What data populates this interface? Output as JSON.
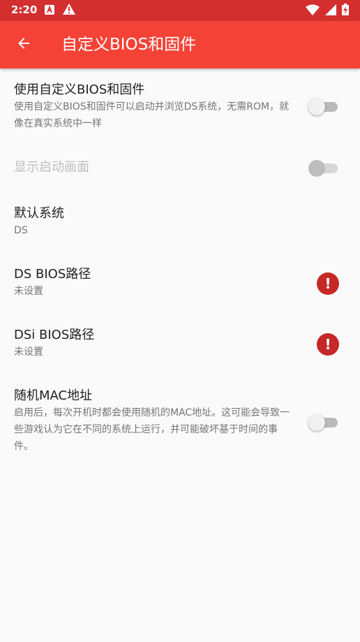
{
  "status_bar": {
    "time": "2:20",
    "left_icons": [
      "a-notification-icon",
      "warning-icon"
    ],
    "right_icons": [
      "wifi-icon",
      "signal-icon",
      "battery-charging-icon"
    ]
  },
  "app_bar": {
    "title": "自定义BIOS和固件",
    "back_icon": "arrow-back-icon"
  },
  "colors": {
    "status_bar": "#d32f2f",
    "app_bar": "#f44336",
    "alert": "#c62828"
  },
  "preferences": [
    {
      "title": "使用自定义BIOS和固件",
      "summary": "使用自定义BIOS和固件可以启动并浏览DS系统，无需ROM，就像在真实系统中一样",
      "widget": "switch",
      "checked": false,
      "enabled": true
    },
    {
      "title": "显示启动画面",
      "summary": "",
      "widget": "switch",
      "checked": false,
      "enabled": false
    },
    {
      "title": "默认系统",
      "summary": "DS",
      "widget": "none",
      "enabled": true
    },
    {
      "title": "DS BIOS路径",
      "summary": "未设置",
      "widget": "alert-icon",
      "alert_glyph": "!",
      "enabled": true
    },
    {
      "title": "DSi BIOS路径",
      "summary": "未设置",
      "widget": "alert-icon",
      "alert_glyph": "!",
      "enabled": true
    },
    {
      "title": "随机MAC地址",
      "summary": "启用后，每次开机时都会使用随机的MAC地址。这可能会导致一些游戏认为它在不同的系统上运行，并可能破坏基于时间的事件。",
      "widget": "switch",
      "checked": false,
      "enabled": true
    }
  ]
}
